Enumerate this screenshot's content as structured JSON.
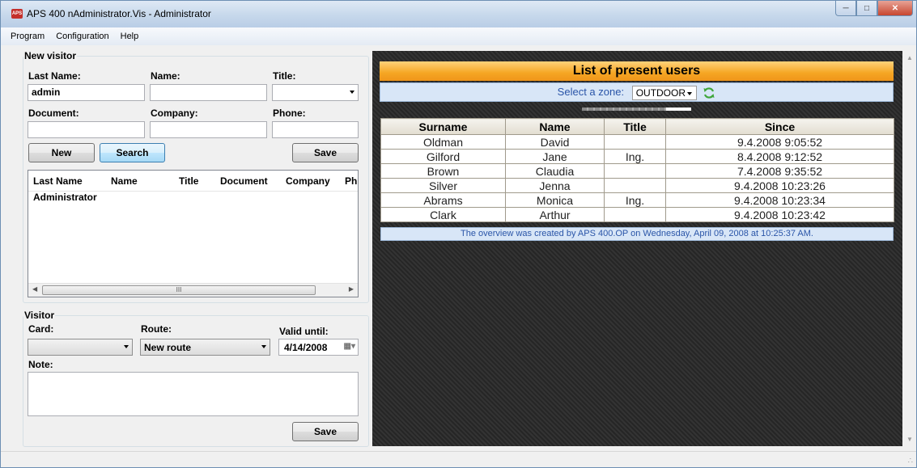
{
  "window": {
    "title": "APS 400 nAdministrator.Vis - Administrator",
    "icon_text": "APS",
    "buttons": [
      "minimize-icon",
      "maximize-icon",
      "close-icon"
    ]
  },
  "menu": [
    "Program",
    "Configuration",
    "Help"
  ],
  "new_visitor": {
    "group_title": "New visitor",
    "last_name_label": "Last Name:",
    "last_name_value": "admin",
    "name_label": "Name:",
    "name_value": "",
    "title_label": "Title:",
    "title_value": "",
    "document_label": "Document:",
    "company_label": "Company:",
    "phone_label": "Phone:",
    "new_button": "New",
    "search_button": "Search",
    "save_button": "Save",
    "list": {
      "columns": [
        "Last Name",
        "Name",
        "Title",
        "Document",
        "Company",
        "Ph"
      ],
      "rows": [
        [
          "Administrator",
          "",
          "",
          "",
          "",
          ""
        ]
      ],
      "scroll_thumb": "III"
    }
  },
  "visitor": {
    "group_title": "Visitor",
    "card_label": "Card:",
    "card_value": "",
    "route_label": "Route:",
    "route_value": "New route",
    "valid_until_label": "Valid until:",
    "valid_until_value": "4/14/2008",
    "note_label": "Note:",
    "save_button": "Save"
  },
  "present_users": {
    "header": "List of present users",
    "zone_label": "Select a zone:",
    "zone_value": "OUTDOOR",
    "progress": 0.77,
    "columns": [
      "Surname",
      "Name",
      "Title",
      "Since"
    ],
    "rows": [
      [
        "Oldman",
        "David",
        "",
        "9.4.2008 9:05:52"
      ],
      [
        "Gilford",
        "Jane",
        "Ing.",
        "8.4.2008 9:12:52"
      ],
      [
        "Brown",
        "Claudia",
        "",
        "7.4.2008 9:35:52"
      ],
      [
        "Silver",
        "Jenna",
        "",
        "9.4.2008 10:23:26"
      ],
      [
        "Abrams",
        "Monica",
        "Ing.",
        "9.4.2008 10:23:34"
      ],
      [
        "Clark",
        "Arthur",
        "",
        "9.4.2008 10:23:42"
      ]
    ],
    "footer": "The overview was created by APS 400.OP on Wednesday, April 09, 2008 at 10:25:37 AM."
  },
  "colors": {
    "header_orange": "#f5a623",
    "zone_blue_text": "#2a55a8",
    "panel_dark": "#2c2c2c"
  }
}
